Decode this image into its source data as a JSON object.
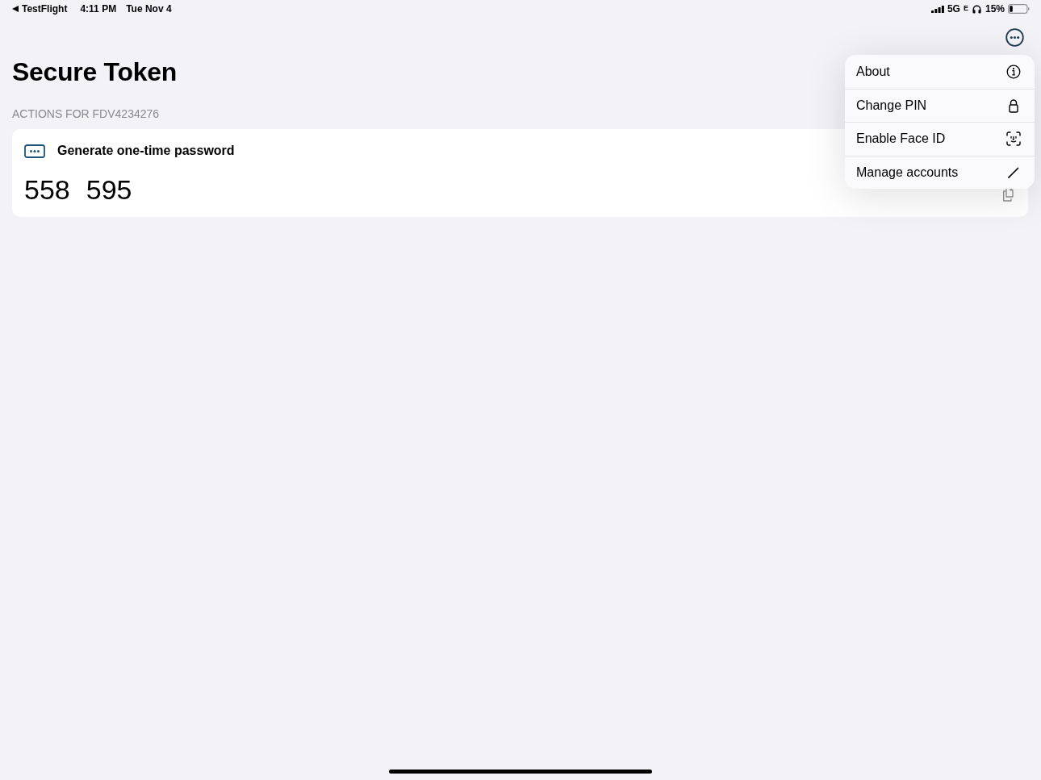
{
  "status_bar": {
    "back_label": "TestFlight",
    "time": "4:11 PM",
    "date": "Tue Nov 4",
    "network": "5G",
    "network_suffix": "E",
    "battery_percent": "15%"
  },
  "title": "Secure Token",
  "section": {
    "header": "ACTIONS FOR FDV4234276",
    "items": [
      {
        "label": "Generate one-time password",
        "code": [
          "558",
          "595"
        ]
      }
    ]
  },
  "menu": {
    "items": [
      {
        "label": "About"
      },
      {
        "label": "Change PIN"
      },
      {
        "label": "Enable Face ID"
      },
      {
        "label": "Manage accounts"
      }
    ]
  }
}
